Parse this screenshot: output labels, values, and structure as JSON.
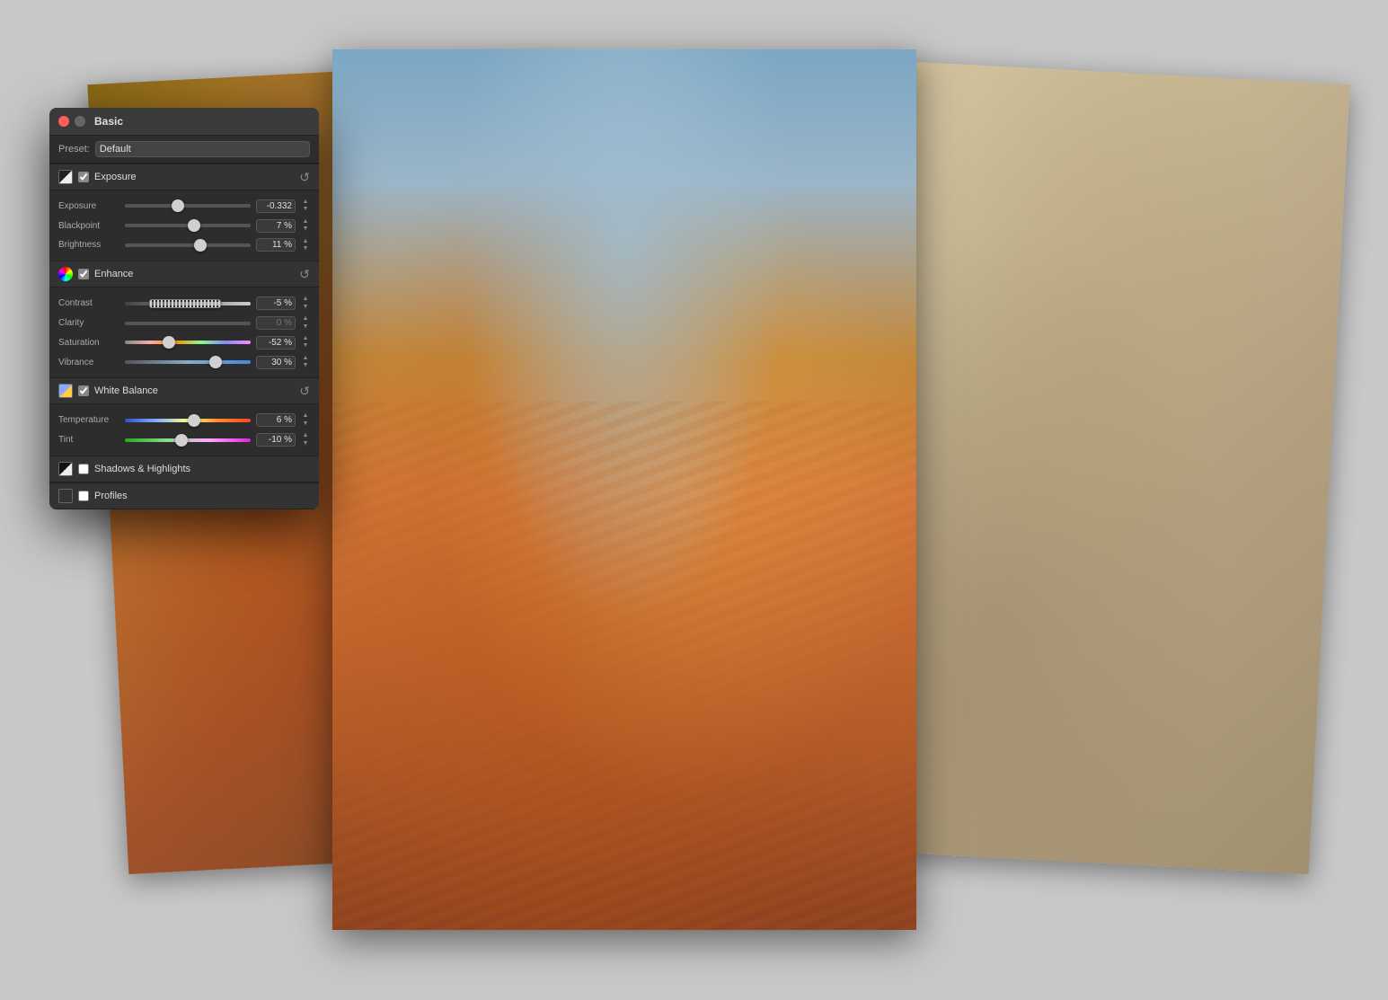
{
  "panel": {
    "title": "Basic",
    "preset_label": "Preset:",
    "preset_value": "Default",
    "sections": {
      "exposure": {
        "label": "Exposure",
        "enabled": true,
        "sliders": [
          {
            "name": "Exposure",
            "value": "-0.332",
            "percent": 42
          },
          {
            "name": "Blackpoint",
            "value": "7 %",
            "percent": 55
          },
          {
            "name": "Brightness",
            "value": "11 %",
            "percent": 60
          }
        ]
      },
      "enhance": {
        "label": "Enhance",
        "enabled": true,
        "sliders": [
          {
            "name": "Contrast",
            "value": "-5 %",
            "percent": 48
          },
          {
            "name": "Clarity",
            "value": "0 %",
            "percent": 50
          },
          {
            "name": "Saturation",
            "value": "-52 %",
            "percent": 35
          },
          {
            "name": "Vibrance",
            "value": "30 %",
            "percent": 72
          }
        ]
      },
      "white_balance": {
        "label": "White Balance",
        "enabled": true,
        "sliders": [
          {
            "name": "Temperature",
            "value": "6 %",
            "percent": 55
          },
          {
            "name": "Tint",
            "value": "-10 %",
            "percent": 45
          }
        ]
      },
      "shadows_highlights": {
        "label": "Shadows & Highlights",
        "enabled": false
      },
      "profiles": {
        "label": "Profiles",
        "enabled": false
      }
    }
  }
}
